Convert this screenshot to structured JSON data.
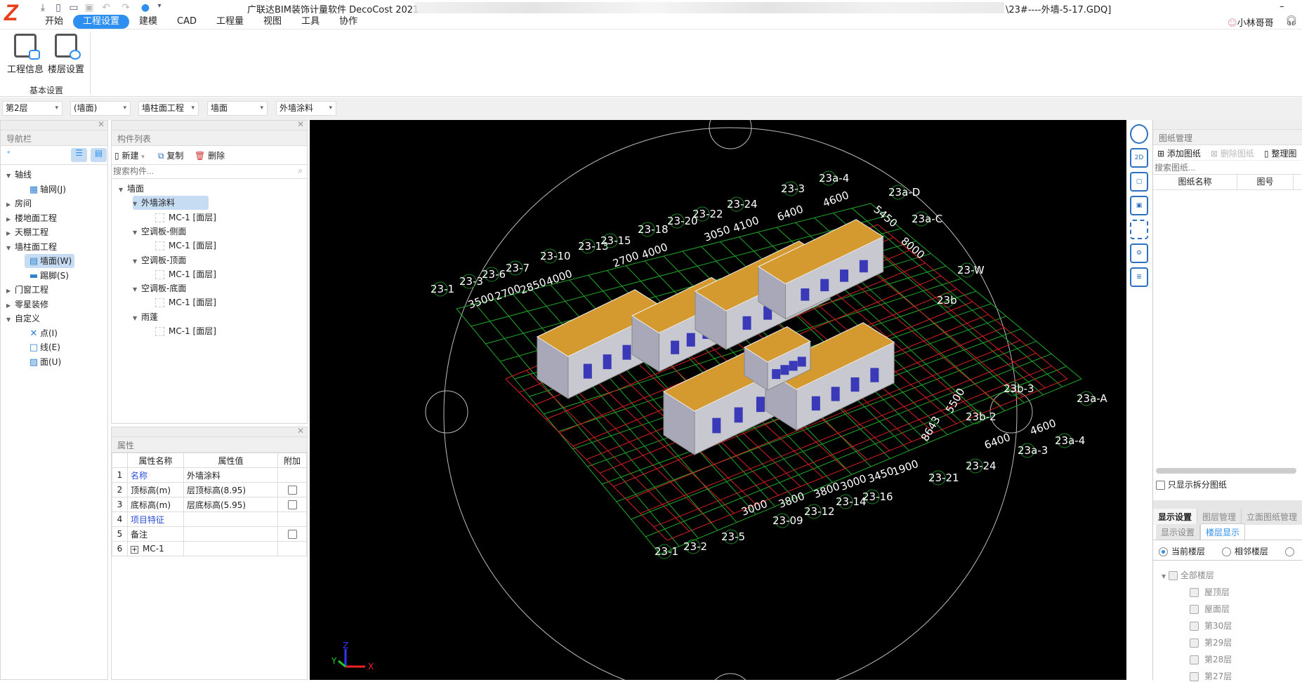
{
  "app": {
    "title": "广联达BIM装饰计量软件 DecoCost 2021",
    "filename": "\\23#----外墙-5-17.GDQ]",
    "user": "小林哥哥",
    "logo_letter": "Z"
  },
  "quick_access": [
    "save-down-icon",
    "new-file-icon",
    "open-folder-icon",
    "save-icon",
    "undo-icon",
    "redo-icon",
    "cloud-icon",
    "customize-icon"
  ],
  "menu_tabs": [
    {
      "label": "开始",
      "active": false
    },
    {
      "label": "工程设置",
      "active": true
    },
    {
      "label": "建模",
      "active": false
    },
    {
      "label": "CAD",
      "active": false
    },
    {
      "label": "工程量",
      "active": false
    },
    {
      "label": "视图",
      "active": false
    },
    {
      "label": "工具",
      "active": false
    },
    {
      "label": "协作",
      "active": false
    }
  ],
  "ribbon": {
    "buttons": [
      {
        "label": "工程信息"
      },
      {
        "label": "楼层设置"
      }
    ],
    "group_label": "基本设置"
  },
  "selectors": [
    "第2层",
    "(墙面)",
    "墙柱面工程",
    "墙面",
    "外墙涂料"
  ],
  "nav": {
    "title": "导航栏",
    "items": [
      {
        "label": "轴线",
        "level": 0,
        "expanded": true
      },
      {
        "label": "轴网(J)",
        "level": 1
      },
      {
        "label": "房间",
        "level": 0,
        "expanded": false
      },
      {
        "label": "楼地面工程",
        "level": 0,
        "expanded": false
      },
      {
        "label": "天棚工程",
        "level": 0,
        "expanded": false
      },
      {
        "label": "墙柱面工程",
        "level": 0,
        "expanded": true
      },
      {
        "label": "墙面(W)",
        "level": 1,
        "selected": true
      },
      {
        "label": "踢脚(S)",
        "level": 1
      },
      {
        "label": "门窗工程",
        "level": 0,
        "expanded": false
      },
      {
        "label": "零星装修",
        "level": 0,
        "expanded": false
      },
      {
        "label": "自定义",
        "level": 0,
        "expanded": true
      },
      {
        "label": "点(I)",
        "level": 1
      },
      {
        "label": "线(E)",
        "level": 1
      },
      {
        "label": "面(U)",
        "level": 1
      }
    ]
  },
  "components": {
    "title": "构件列表",
    "new_label": "新建",
    "copy_label": "复制",
    "delete_label": "删除",
    "search_placeholder": "搜索构件...",
    "tree": [
      {
        "label": "墙面",
        "level": 0
      },
      {
        "label": "外墙涂料",
        "level": 1,
        "selected": true
      },
      {
        "label": "MC-1 [面层]",
        "level": 2
      },
      {
        "label": "空调板-侧面",
        "level": 1
      },
      {
        "label": "MC-1 [面层]",
        "level": 2
      },
      {
        "label": "空调板-顶面",
        "level": 1
      },
      {
        "label": "MC-1 [面层]",
        "level": 2
      },
      {
        "label": "空调板-底面",
        "level": 1
      },
      {
        "label": "MC-1 [面层]",
        "level": 2
      },
      {
        "label": "雨蓬",
        "level": 1
      },
      {
        "label": "MC-1 [面层]",
        "level": 2
      }
    ]
  },
  "properties": {
    "title": "属性",
    "headers": [
      "属性名称",
      "属性值",
      "附加"
    ],
    "rows": [
      {
        "no": "1",
        "name": "名称",
        "value": "外墙涂料",
        "blue": true,
        "checkbox": false
      },
      {
        "no": "2",
        "name": "顶标高(m)",
        "value": "层顶标高(8.95)",
        "blue": false,
        "checkbox": true
      },
      {
        "no": "3",
        "name": "底标高(m)",
        "value": "层底标高(5.95)",
        "blue": false,
        "checkbox": true
      },
      {
        "no": "4",
        "name": "项目特征",
        "value": "",
        "blue": true,
        "checkbox": false
      },
      {
        "no": "5",
        "name": "备注",
        "value": "",
        "blue": false,
        "checkbox": true
      },
      {
        "no": "6",
        "name": "MC-1",
        "value": "",
        "blue": false,
        "checkbox": false,
        "expandable": true
      }
    ]
  },
  "viewport": {
    "background": "#000000",
    "axis_labels": [
      "23-1",
      "23-3",
      "23-6",
      "23-7",
      "23-10",
      "23-13",
      "23-15",
      "23-18",
      "23-20",
      "23-22",
      "23-24",
      "23-3",
      "23a-4",
      "23a-D",
      "23a-C",
      "23-W",
      "23b",
      "23b-3",
      "23b-2",
      "23a-A",
      "23a-4",
      "23a-3",
      "23-24",
      "23-21",
      "23-16",
      "23-14",
      "23-12",
      "23-09",
      "23-5",
      "23-2",
      "23-1"
    ],
    "dimension_labels": [
      "3500",
      "2700",
      "2850",
      "4000",
      "2700",
      "4000",
      "3050",
      "4100",
      "6400",
      "4600",
      "5450",
      "8000",
      "5500",
      "8643",
      "4600",
      "6400",
      "3000",
      "3800",
      "3800",
      "3000",
      "3450",
      "1900"
    ],
    "axes": {
      "x": "X",
      "y": "Y",
      "z": "Z"
    }
  },
  "view_tools": [
    "orbit-icon",
    "2d-view-icon",
    "3d-box-icon",
    "3d-view-icon",
    "fit-view-icon",
    "settings-view-icon",
    "properties-icon"
  ],
  "drawings": {
    "title": "图纸管理",
    "add_label": "添加图纸",
    "delete_label": "删除图纸",
    "organize_label": "整理图",
    "search_placeholder": "搜索图纸...",
    "headers": [
      "图纸名称",
      "图号"
    ],
    "only_split_label": "只显示拆分图纸"
  },
  "display": {
    "tabs": [
      "显示设置",
      "图层管理",
      "立面图纸管理"
    ],
    "subtabs": [
      "显示设置",
      "楼层显示"
    ],
    "active_subtab": "楼层显示",
    "radios": [
      {
        "label": "当前楼层",
        "checked": true
      },
      {
        "label": "相邻楼层",
        "checked": false
      }
    ],
    "all_floors_label": "全部楼层",
    "floors": [
      "屋顶层",
      "屋面层",
      "第30层",
      "第29层",
      "第28层",
      "第27层"
    ]
  },
  "colors": {
    "accent": "#2d8ff0",
    "grid_red": "#d42020",
    "grid_green": "#1fa82a",
    "roof": "#d49a30"
  }
}
